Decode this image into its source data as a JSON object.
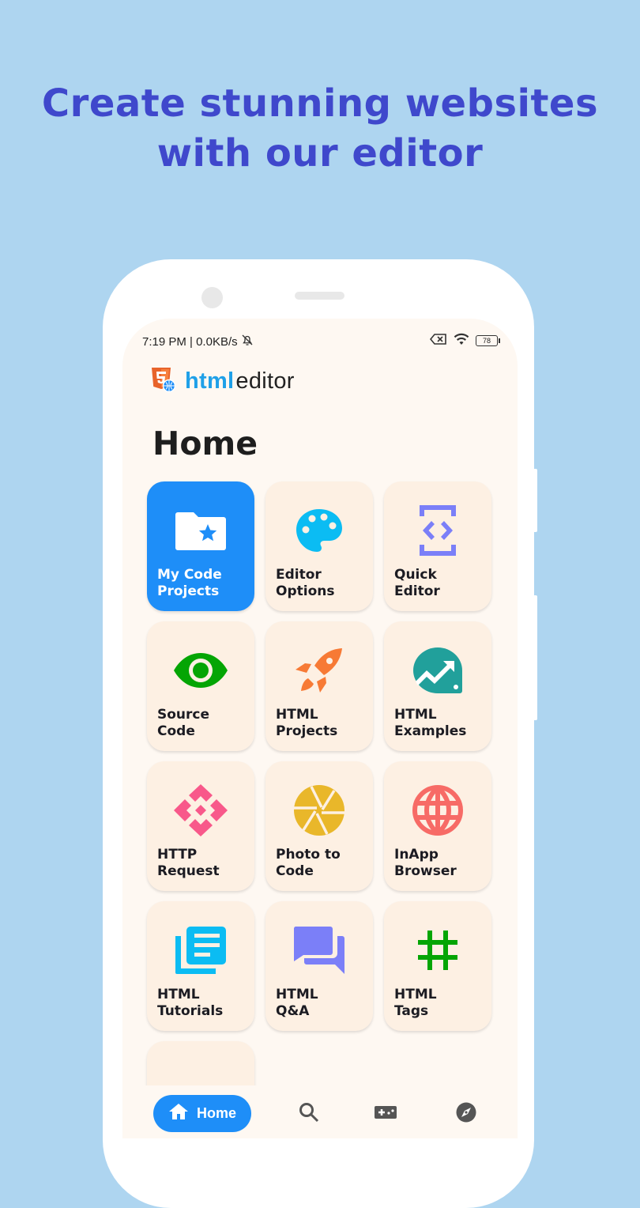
{
  "headline": {
    "line1": "Create stunning websites",
    "line2": "with our editor"
  },
  "status_bar": {
    "time_speed": "7:19 PM | 0.0KB/s",
    "icons_left": [
      "bell-off-icon"
    ],
    "icons_right": [
      "sim-no-signal-icon",
      "wifi-icon",
      "battery-icon"
    ],
    "battery_level": "78"
  },
  "app": {
    "logo_icon": "html5-globe-logo",
    "name_part1": "html",
    "name_part2": "editor"
  },
  "page": {
    "title": "Home"
  },
  "tiles": [
    {
      "label": "My Code\nProjects",
      "icon": "folder-star-icon",
      "color": "#ffffff",
      "active": true
    },
    {
      "label": "Editor\nOptions",
      "icon": "palette-icon",
      "color": "#0bbcf3"
    },
    {
      "label": "Quick\nEditor",
      "icon": "code-device-icon",
      "color": "#7b7ff8"
    },
    {
      "label": "Source\nCode",
      "icon": "eye-icon",
      "color": "#04a504"
    },
    {
      "label": "HTML\nProjects",
      "icon": "rocket-icon",
      "color": "#f77a35"
    },
    {
      "label": "HTML\nExamples",
      "icon": "trending-chat-icon",
      "color": "#21a09b"
    },
    {
      "label": "HTTP\nRequest",
      "icon": "api-diamond-icon",
      "color": "#f8588a"
    },
    {
      "label": "Photo to\nCode",
      "icon": "camera-shutter-icon",
      "color": "#e9b72a"
    },
    {
      "label": "InApp\nBrowser",
      "icon": "globe-icon",
      "color": "#f76b66"
    },
    {
      "label": "HTML\nTutorials",
      "icon": "articles-icon",
      "color": "#0bbcf3"
    },
    {
      "label": "HTML\nQ&A",
      "icon": "forum-icon",
      "color": "#7b7ff8"
    },
    {
      "label": "HTML\nTags",
      "icon": "hashtag-icon",
      "color": "#04a504"
    },
    {
      "label": "",
      "icon": "grid-blocks-icon",
      "color": "#f8588a"
    }
  ],
  "bottom_nav": {
    "home_label": "Home",
    "items": [
      "home-icon",
      "search-icon",
      "gamepad-icon",
      "compass-icon"
    ]
  },
  "colors": {
    "background": "#aed5f0",
    "headline": "#3f48cc",
    "accent": "#1e8ef8",
    "tile_bg": "#fdf0e3",
    "screen_bg": "#fef8f2"
  }
}
